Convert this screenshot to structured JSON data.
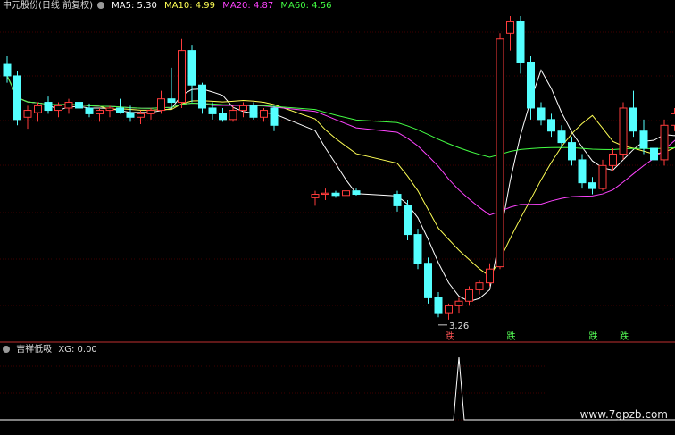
{
  "header": {
    "title": "中元股份(日线 前复权)",
    "ma5": "MA5: 5.30",
    "ma10": "MA10: 4.99",
    "ma20": "MA20: 4.87",
    "ma60": "MA60: 4.56",
    "colors": {
      "ma5": "#ffffff",
      "ma10": "#ffff55",
      "ma20": "#ff44ff",
      "ma60": "#44ff44"
    }
  },
  "indicator": {
    "name": "吉祥低吸",
    "value": "XG: 0.00"
  },
  "annotations": {
    "low_label": "3.26",
    "tags": [
      "跌",
      "跌",
      "跌",
      "跌",
      "涨"
    ]
  },
  "watermark": "www.7gpzb.com",
  "chart_data": {
    "type": "candlestick",
    "colors": {
      "up": "#ff3c3c",
      "down": "#54ffff",
      "ma5": "#ffffff",
      "ma10": "#ffff55",
      "ma20": "#ff44ff",
      "ma60": "#44ff44",
      "indicator": "#ffffff",
      "grid": "#800000"
    },
    "price_range": [
      3.15,
      5.9
    ],
    "candles": [
      [
        5.48,
        5.55,
        5.32,
        5.38
      ],
      [
        5.38,
        5.42,
        4.95,
        5.0
      ],
      [
        5.02,
        5.12,
        4.92,
        5.08
      ],
      [
        5.06,
        5.15,
        4.98,
        5.12
      ],
      [
        5.15,
        5.2,
        5.05,
        5.08
      ],
      [
        5.08,
        5.15,
        5.02,
        5.12
      ],
      [
        5.1,
        5.18,
        5.05,
        5.15
      ],
      [
        5.15,
        5.2,
        5.08,
        5.1
      ],
      [
        5.1,
        5.14,
        5.02,
        5.05
      ],
      [
        5.05,
        5.1,
        4.98,
        5.08
      ],
      [
        5.08,
        5.12,
        5.02,
        5.1
      ],
      [
        5.1,
        5.18,
        5.05,
        5.06
      ],
      [
        5.06,
        5.12,
        4.98,
        5.02
      ],
      [
        5.02,
        5.08,
        4.96,
        5.05
      ],
      [
        5.05,
        5.1,
        5.0,
        5.08
      ],
      [
        5.08,
        5.25,
        5.05,
        5.18
      ],
      [
        5.18,
        5.45,
        5.1,
        5.15
      ],
      [
        5.15,
        5.7,
        5.1,
        5.6
      ],
      [
        5.6,
        5.65,
        5.15,
        5.3
      ],
      [
        5.3,
        5.32,
        5.05,
        5.1
      ],
      [
        5.1,
        5.15,
        5.0,
        5.05
      ],
      [
        5.05,
        5.1,
        4.98,
        5.0
      ],
      [
        5.0,
        5.12,
        4.98,
        5.08
      ],
      [
        5.08,
        5.15,
        5.02,
        5.12
      ],
      [
        5.12,
        5.15,
        5.0,
        5.02
      ],
      [
        5.02,
        5.1,
        4.98,
        5.08
      ],
      [
        5.1,
        5.12,
        4.9,
        4.95
      ],
      [
        4.32,
        4.38,
        4.25,
        4.35
      ],
      [
        4.35,
        4.4,
        4.3,
        4.36
      ],
      [
        4.36,
        4.38,
        4.32,
        4.34
      ],
      [
        4.34,
        4.4,
        4.3,
        4.38
      ],
      [
        4.38,
        4.4,
        4.34,
        4.35
      ],
      [
        4.35,
        4.38,
        4.2,
        4.25
      ],
      [
        4.25,
        4.3,
        3.95,
        4.0
      ],
      [
        4.0,
        4.05,
        3.7,
        3.75
      ],
      [
        3.75,
        3.8,
        3.4,
        3.45
      ],
      [
        3.45,
        3.5,
        3.28,
        3.32
      ],
      [
        3.32,
        3.4,
        3.26,
        3.38
      ],
      [
        3.38,
        3.45,
        3.32,
        3.42
      ],
      [
        3.42,
        3.55,
        3.38,
        3.52
      ],
      [
        3.52,
        3.6,
        3.48,
        3.58
      ],
      [
        3.58,
        3.75,
        3.55,
        3.7
      ],
      [
        3.72,
        5.75,
        3.7,
        5.7
      ],
      [
        5.75,
        5.9,
        5.6,
        5.85
      ],
      [
        5.85,
        5.9,
        5.4,
        5.5
      ],
      [
        5.5,
        5.55,
        5.0,
        5.1
      ],
      [
        5.1,
        5.15,
        4.95,
        5.0
      ],
      [
        5.0,
        5.05,
        4.85,
        4.9
      ],
      [
        4.9,
        4.95,
        4.75,
        4.8
      ],
      [
        4.8,
        4.85,
        4.6,
        4.65
      ],
      [
        4.65,
        4.7,
        4.4,
        4.45
      ],
      [
        4.45,
        4.5,
        4.35,
        4.4
      ],
      [
        4.4,
        4.65,
        4.38,
        4.6
      ],
      [
        4.6,
        4.75,
        4.55,
        4.7
      ],
      [
        4.7,
        5.15,
        4.65,
        5.1
      ],
      [
        5.1,
        5.25,
        4.85,
        4.9
      ],
      [
        4.9,
        5.0,
        4.7,
        4.75
      ],
      [
        4.75,
        4.85,
        4.6,
        4.65
      ],
      [
        4.65,
        5.0,
        4.6,
        4.95
      ],
      [
        4.95,
        5.1,
        4.9,
        5.05
      ],
      [
        5.05,
        5.12,
        5.0,
        5.1
      ],
      [
        5.1,
        5.2,
        5.05,
        5.15
      ],
      [
        5.15,
        5.45,
        5.1,
        5.4
      ],
      [
        5.4,
        5.7,
        5.35,
        5.65
      ]
    ],
    "gaps_after": [
      26,
      31
    ],
    "low_marker": {
      "index": 36,
      "value": 3.26
    },
    "tag_candles": [
      37,
      43,
      51,
      54,
      63
    ],
    "indicator_peak_index": 38,
    "indicator_peak": 1,
    "indicator_value": 0.0
  }
}
